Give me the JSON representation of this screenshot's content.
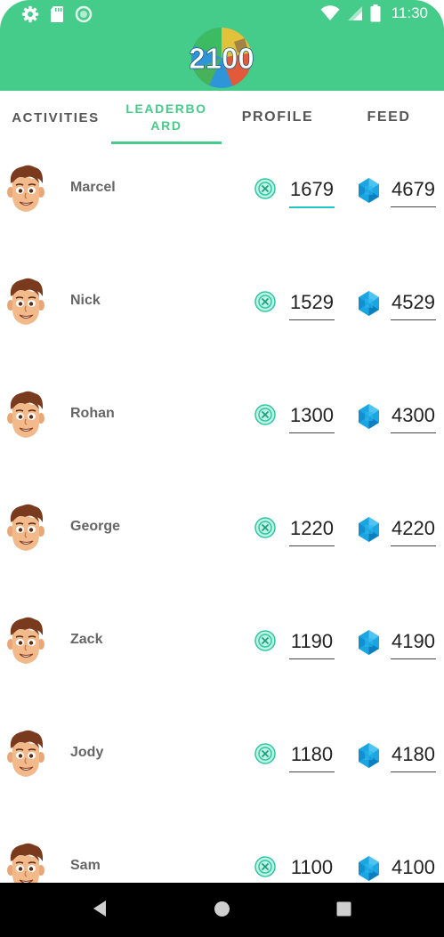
{
  "status_bar": {
    "time": "11:30"
  },
  "logo": {
    "text": "2100"
  },
  "tabs": [
    {
      "label": "ACTIVITIES"
    },
    {
      "label": "LEADERBO\nARD"
    },
    {
      "label": "PROFILE"
    },
    {
      "label": "FEED"
    }
  ],
  "active_tab": 1,
  "leaderboard": [
    {
      "name": "Marcel",
      "points": "1679",
      "gems": "4679"
    },
    {
      "name": "Nick",
      "points": "1529",
      "gems": "4529"
    },
    {
      "name": "Rohan",
      "points": "1300",
      "gems": "4300"
    },
    {
      "name": "George",
      "points": "1220",
      "gems": "4220"
    },
    {
      "name": "Zack",
      "points": "1190",
      "gems": "4190"
    },
    {
      "name": "Jody",
      "points": "1180",
      "gems": "4180"
    },
    {
      "name": "Sam",
      "points": "1100",
      "gems": "4100"
    }
  ],
  "colors": {
    "header": "#45CC8A",
    "accent": "#45CC8A",
    "focus": "#1ec6c6",
    "gem": "#1aa6e0"
  }
}
